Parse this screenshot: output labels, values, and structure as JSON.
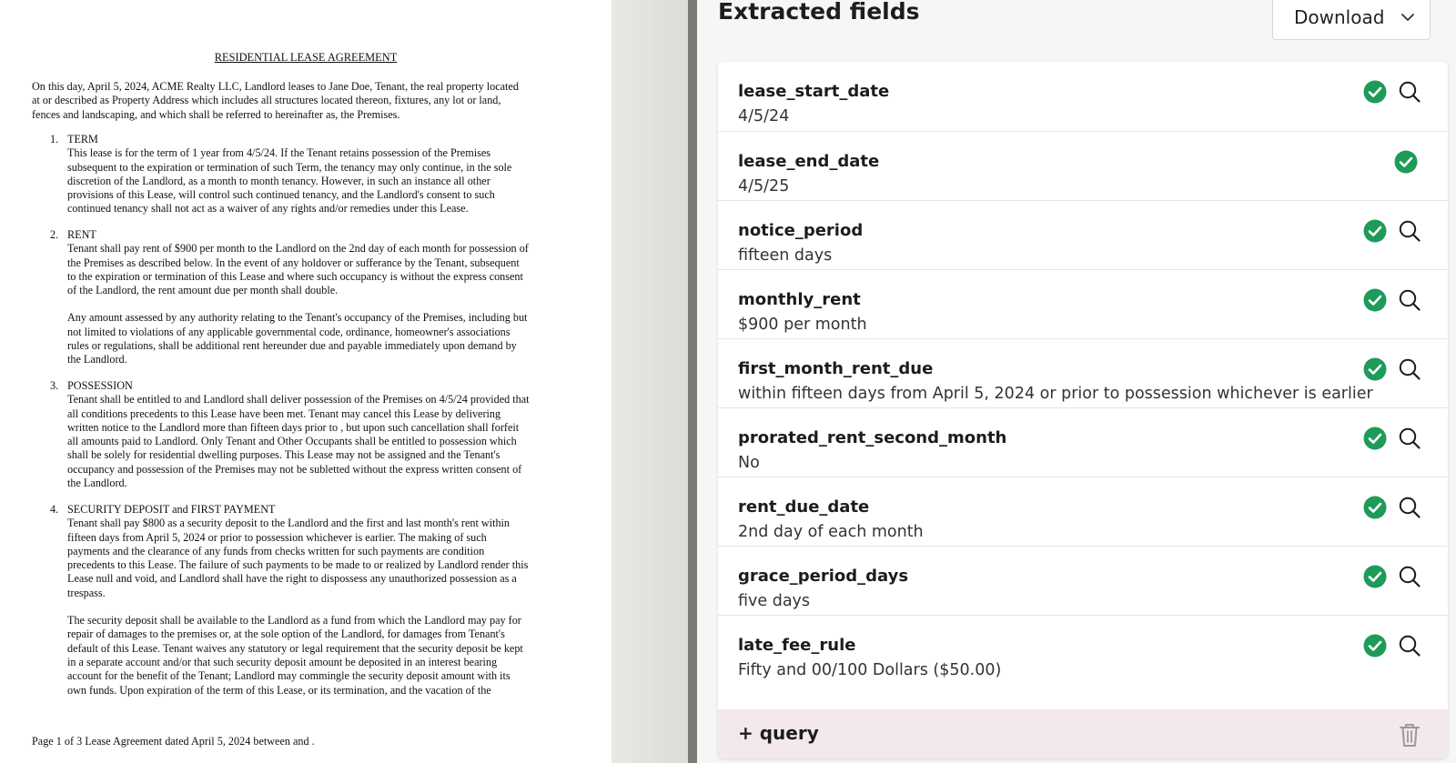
{
  "document": {
    "title": "RESIDENTIAL LEASE AGREEMENT",
    "intro_lines": [
      "On this day, April 5, 2024, ACME Realty LLC, Landlord leases to Jane Doe, Tenant, the real property located",
      "at or described as Property Address which includes all structures located thereon, fixtures, any lot or land,",
      "fences and landscaping, and which shall be referred to hereinafter as, the Premises."
    ],
    "sections": [
      {
        "number": "1.",
        "heading": "TERM",
        "paragraphs": [
          [
            "This lease is for the term of 1 year from 4/5/24.  If the Tenant retains possession of the Premises",
            "subsequent to the expiration or termination of such Term, the tenancy may only continue, in the sole",
            "discretion of the Landlord, as a month to month tenancy.  However, in such an instance all other",
            "provisions of this Lease, will control such continued tenancy, and the Landlord's consent to such",
            "continued tenancy shall not act as a waiver of any rights and/or remedies under this Lease."
          ]
        ]
      },
      {
        "number": "2.",
        "heading": "RENT",
        "paragraphs": [
          [
            "Tenant shall pay rent of $900 per month to the Landlord on the 2nd day of each month for possession of",
            "the Premises as described below.  In the event of any holdover or sufferance by the Tenant, subsequent",
            "to the expiration or termination of this Lease and where such occupancy is without the express consent",
            "of the Landlord, the rent amount due per month shall double."
          ],
          [
            "Any amount assessed by any authority relating to the Tenant's occupancy of the Premises, including but",
            "not limited to violations of any applicable governmental code, ordinance, homeowner's associations",
            "rules or regulations, shall be additional rent hereunder due and payable immediately upon demand by",
            "the Landlord."
          ]
        ]
      },
      {
        "number": "3.",
        "heading": "POSSESSION",
        "paragraphs": [
          [
            "Tenant shall be entitled to and Landlord shall deliver possession of the Premises on 4/5/24 provided that",
            "all conditions precedents to this Lease have been met.  Tenant may cancel this Lease by delivering",
            "written notice to the Landlord more than fifteen days prior to , but upon such cancellation shall forfeit",
            "all amounts paid to Landlord.  Only Tenant and Other Occupants shall be entitled to possession which",
            "shall be solely for residential dwelling purposes.  This Lease may not be assigned and the Tenant's",
            "occupancy and possession of the Premises may not be subletted without the express written consent of",
            "the Landlord."
          ]
        ]
      },
      {
        "number": "4.",
        "heading": "SECURITY DEPOSIT and FIRST PAYMENT",
        "paragraphs": [
          [
            "Tenant shall pay $800 as a security deposit to the Landlord and the first and last month's rent within",
            "fifteen days from April 5, 2024 or prior to possession whichever is earlier.  The making of such",
            "payments and the clearance of any funds from checks written for such payments are condition",
            "precedents to this Lease.  The failure of such payments to be made to or realized by Landlord render this",
            "Lease null and void, and Landlord shall have the right to dispossess any unauthorized possession as a",
            "trespass."
          ],
          [
            "The security deposit shall be available to the Landlord as a fund from which the Landlord may pay for",
            "repair of damages to the premises or, at the sole option of the Landlord, for damages from Tenant's",
            "default of this Lease.  Tenant waives any statutory or legal requirement that the security deposit be kept",
            "in a separate account and/or that such security deposit amount be deposited in an interest bearing",
            "account for the benefit of the Tenant; Landlord may commingle the security deposit amount with its",
            "own funds.  Upon expiration of the term of this Lease, or its termination, and the vacation of the"
          ]
        ]
      }
    ],
    "footer": "Page 1 of 3 Lease Agreement dated April 5, 2024 between  and ."
  },
  "panel": {
    "title": "Extracted fields",
    "download_label": "Download",
    "fields": [
      {
        "name": "lease_start_date",
        "value": "4/5/24",
        "verified": true,
        "searchable": true
      },
      {
        "name": "lease_end_date",
        "value": "4/5/25",
        "verified": true,
        "searchable": false
      },
      {
        "name": "notice_period",
        "value": "fifteen days",
        "verified": true,
        "searchable": true
      },
      {
        "name": "monthly_rent",
        "value": "$900 per month",
        "verified": true,
        "searchable": true
      },
      {
        "name": "first_month_rent_due",
        "value": "within fifteen days from April 5, 2024 or prior to possession whichever is earlier",
        "verified": true,
        "searchable": true
      },
      {
        "name": "prorated_rent_second_month",
        "value": "No",
        "verified": true,
        "searchable": true
      },
      {
        "name": "rent_due_date",
        "value": "2nd day of each month",
        "verified": true,
        "searchable": true
      },
      {
        "name": "grace_period_days",
        "value": "five days",
        "verified": true,
        "searchable": true
      },
      {
        "name": "late_fee_rule",
        "value": "Fifty and 00/100 Dollars ($50.00)",
        "verified": true,
        "searchable": true
      }
    ],
    "query_label": "+ query"
  },
  "colors": {
    "verified_green": "#1e9b59",
    "query_bg": "#f4e8ef",
    "divider_dark": "#7c7c77"
  },
  "icons": {
    "verified": "check-circle-icon",
    "search": "search-icon",
    "dropdown": "chevron-down-icon",
    "delete": "trash-icon"
  }
}
